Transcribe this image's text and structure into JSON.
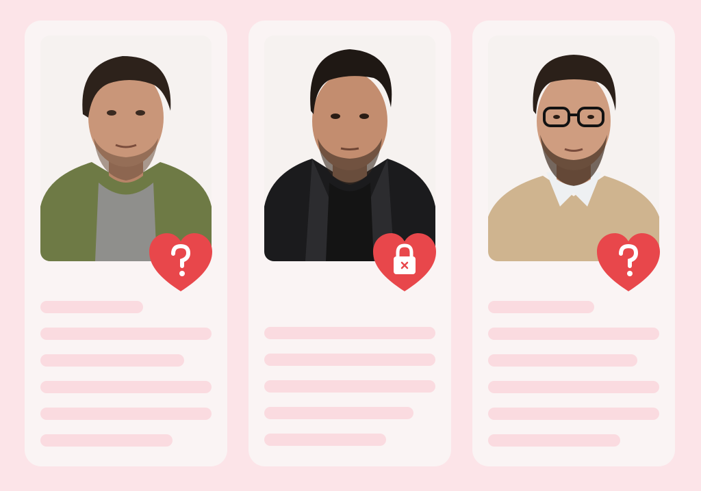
{
  "profiles": [
    {
      "badge_icon": "question-heart-icon",
      "photo_description": "man-olive-shirt",
      "colors": {
        "shirt": "#6e7a45",
        "tee": "#8f8f8c",
        "hair": "#2d221b",
        "skin": "#c99679"
      },
      "text_lines": [
        0.6,
        1.0,
        0.84,
        1.0,
        1.0,
        0.77
      ]
    },
    {
      "badge_icon": "lock-heart-icon",
      "photo_description": "man-leather-jacket",
      "colors": {
        "shirt": "#1b1b1d",
        "tee": "#141414",
        "hair": "#1f1814",
        "skin": "#c38d6f"
      },
      "text_lines": [
        1.0,
        1.0,
        1.0,
        0.87,
        0.71
      ]
    },
    {
      "badge_icon": "question-heart-icon",
      "photo_description": "man-glasses-sweater",
      "colors": {
        "shirt": "#cfb48f",
        "tee": "#eef0f2",
        "hair": "#2b2019",
        "skin": "#cf9d80"
      },
      "text_lines": [
        0.62,
        1.0,
        0.87,
        1.0,
        1.0,
        0.77
      ]
    }
  ],
  "theme": {
    "background": "#fce4e8",
    "card": "#faf4f4",
    "placeholder": "#fadbe0",
    "heart": "#e8474b"
  }
}
